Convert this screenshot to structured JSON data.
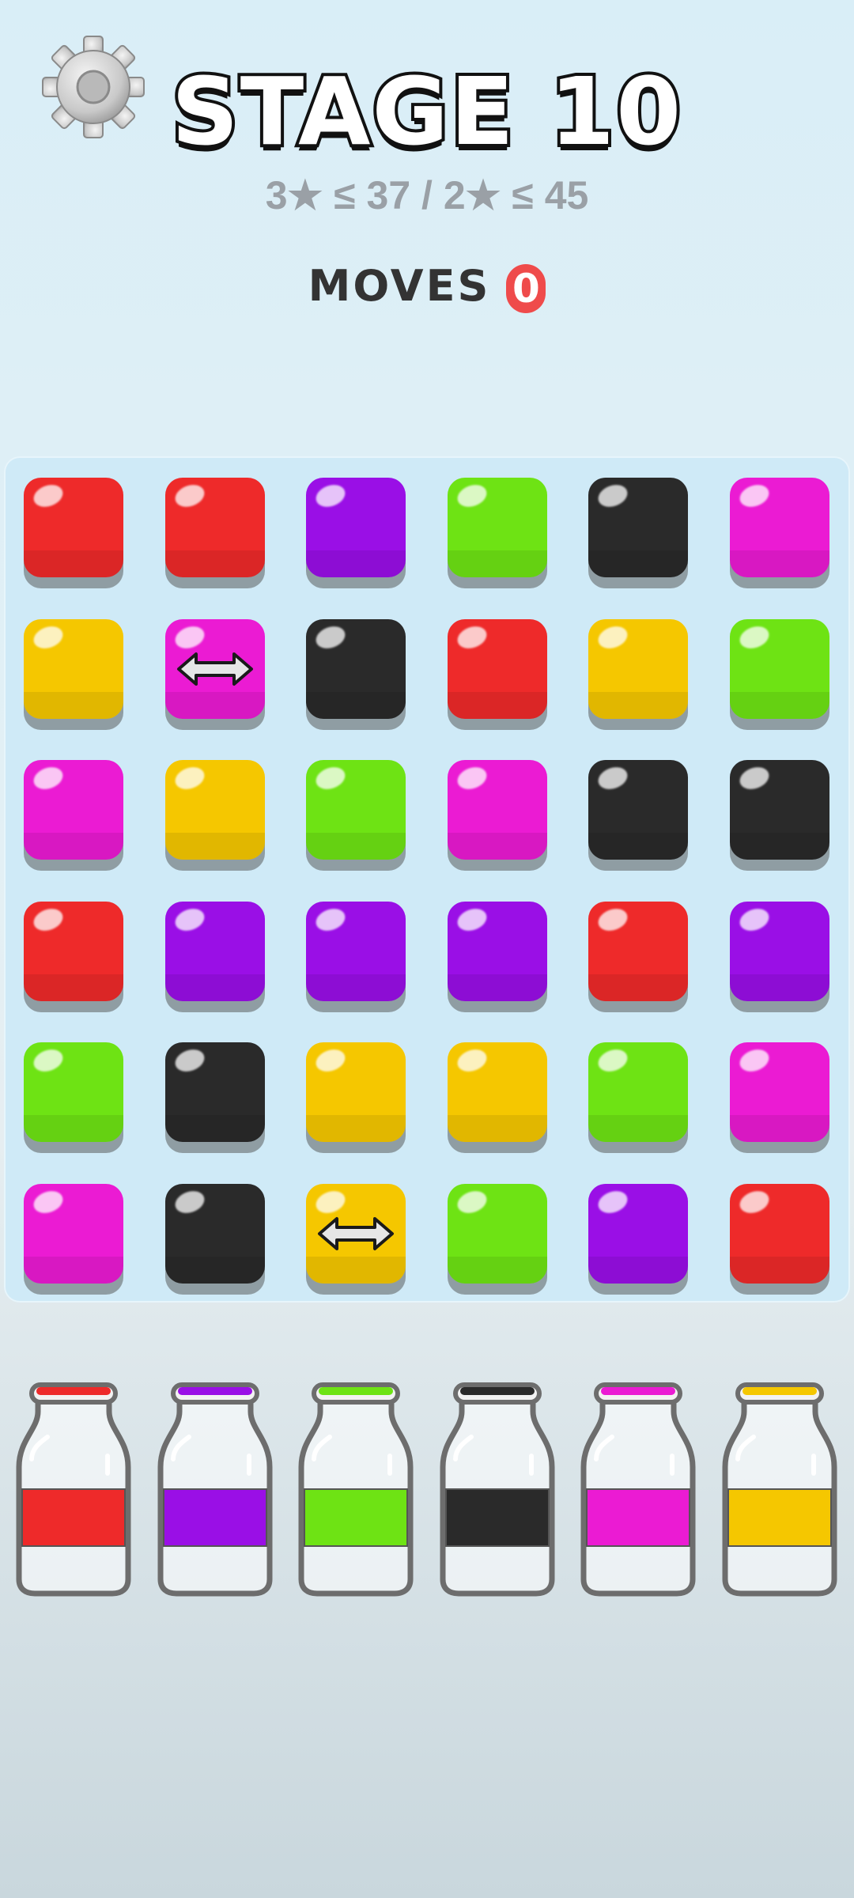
{
  "header": {
    "title": "STAGE 10",
    "star_thresholds": "3★ ≤ 37 / 2★ ≤ 45",
    "moves_label": "MOVES",
    "moves_value": "0"
  },
  "icons": {
    "settings": "gear-icon",
    "swap": "double-arrow-icon"
  },
  "colors": {
    "red": "#ee2a2a",
    "purple": "#9a0fe6",
    "green": "#6ee314",
    "black": "#2a2a2a",
    "magenta": "#eb1bd3",
    "yellow": "#f5c700"
  },
  "board": {
    "rows": [
      [
        "red",
        "red",
        "purple",
        "green",
        "black",
        "magenta"
      ],
      [
        "yellow",
        "magenta",
        "black",
        "red",
        "yellow",
        "green"
      ],
      [
        "magenta",
        "yellow",
        "green",
        "magenta",
        "black",
        "black"
      ],
      [
        "red",
        "purple",
        "purple",
        "purple",
        "red",
        "purple"
      ],
      [
        "green",
        "black",
        "yellow",
        "yellow",
        "green",
        "magenta"
      ],
      [
        "magenta",
        "black",
        "yellow",
        "green",
        "purple",
        "red"
      ]
    ],
    "swap_tiles": [
      [
        1,
        1
      ],
      [
        5,
        2
      ]
    ]
  },
  "bottles": [
    "red",
    "purple",
    "green",
    "black",
    "magenta",
    "yellow"
  ]
}
